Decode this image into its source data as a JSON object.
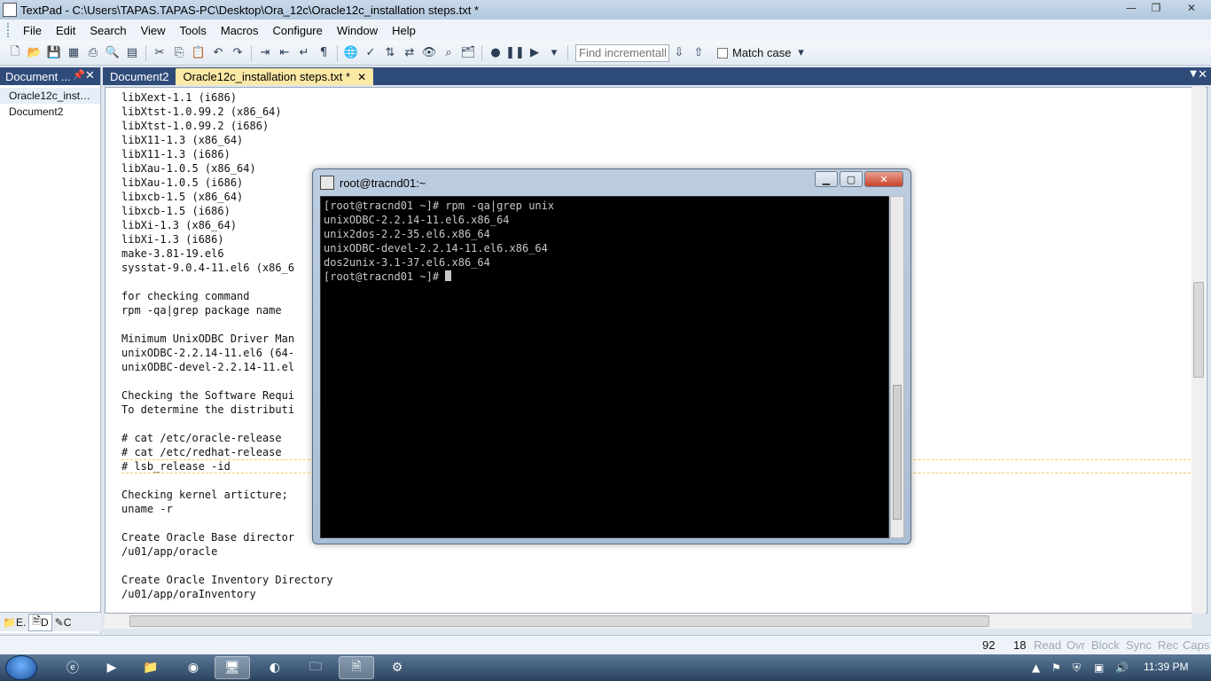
{
  "window": {
    "title": "TextPad - C:\\Users\\TAPAS.TAPAS-PC\\Desktop\\Ora_12c\\Oracle12c_installation steps.txt *",
    "minimize": "—",
    "maximize": "❐",
    "close": "✕"
  },
  "menu": [
    "File",
    "Edit",
    "Search",
    "View",
    "Tools",
    "Macros",
    "Configure",
    "Window",
    "Help"
  ],
  "toolbar": {
    "find_placeholder": "Find incrementally",
    "match_case_label": "Match case"
  },
  "doc_panel": {
    "title": "Document ...",
    "pin": "📌",
    "close": "✕",
    "items": [
      "Oracle12c_installa...",
      "Document2"
    ],
    "bottom_tabs": [
      "E.",
      "D",
      "C"
    ]
  },
  "tabs": [
    {
      "label": "Document2",
      "active": false
    },
    {
      "label": "Oracle12c_installation steps.txt *",
      "active": true
    }
  ],
  "editor": {
    "lines": [
      "libXext-1.1 (i686)",
      "libXtst-1.0.99.2 (x86_64)",
      "libXtst-1.0.99.2 (i686)",
      "libX11-1.3 (x86_64)",
      "libX11-1.3 (i686)",
      "libXau-1.0.5 (x86_64)",
      "libXau-1.0.5 (i686)",
      "libxcb-1.5 (x86_64)",
      "libxcb-1.5 (i686)",
      "libXi-1.3 (x86_64)",
      "libXi-1.3 (i686)",
      "make-3.81-19.el6",
      "sysstat-9.0.4-11.el6 (x86_6",
      "",
      "for checking command",
      "rpm -qa|grep package name",
      "",
      "Minimum UnixODBC Driver Man",
      "unixODBC-2.2.14-11.el6 (64-",
      "unixODBC-devel-2.2.14-11.el",
      "",
      "Checking the Software Requi",
      "To determine the distributi",
      "",
      "# cat /etc/oracle-release",
      "# cat /etc/redhat-release",
      "# lsb_release -id",
      "",
      "Checking kernel articture;",
      "uname -r",
      "",
      "Create Oracle Base director",
      "/u01/app/oracle",
      "",
      "Create Oracle Inventory Directory",
      "/u01/app/oraInventory"
    ]
  },
  "terminal": {
    "title": "root@tracnd01:~",
    "lines": [
      "[root@tracnd01 ~]# rpm -qa|grep unix",
      "unixODBC-2.2.14-11.el6.x86_64",
      "unix2dos-2.2-35.el6.x86_64",
      "unixODBC-devel-2.2.14-11.el6.x86_64",
      "dos2unix-3.1-37.el6.x86_64"
    ],
    "prompt": "[root@tracnd01 ~]# "
  },
  "status": {
    "line": "92",
    "column": "18",
    "flags": [
      "Read",
      "Ovr",
      "Block",
      "Sync",
      "Rec",
      "Caps"
    ]
  },
  "taskbar": {
    "clock": "11:39 PM"
  }
}
